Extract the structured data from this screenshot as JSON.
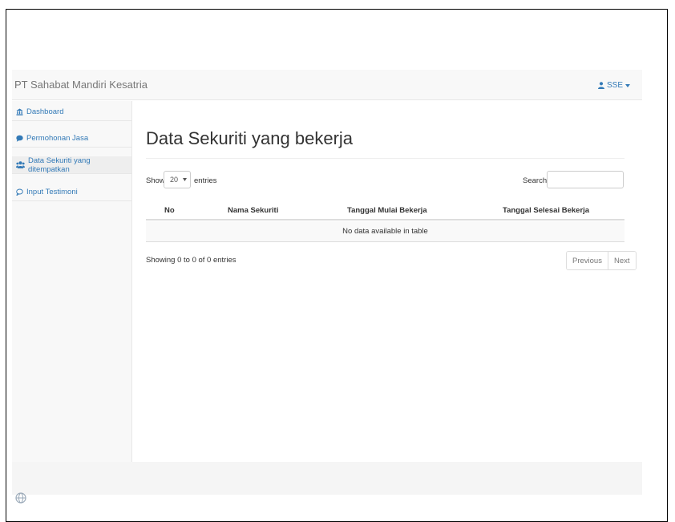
{
  "navbar": {
    "brand": "PT Sahabat Mandiri Kesatria",
    "user_label": "SSE"
  },
  "sidebar": {
    "items": [
      {
        "label": "Dashboard",
        "icon": "bank-icon",
        "active": false
      },
      {
        "label": "Permohonan Jasa",
        "icon": "comment-icon",
        "active": false
      },
      {
        "label": "Data Sekuriti yang ditempatkan",
        "icon": "users-icon",
        "active": true
      },
      {
        "label": "Input Testimoni",
        "icon": "comment-outline-icon",
        "active": false
      }
    ]
  },
  "main": {
    "title": "Data Sekuriti yang bekerja",
    "length": {
      "show_label": "Show",
      "selected": "20",
      "entries_label": "entries"
    },
    "search_label": "Search:",
    "columns": [
      "No",
      "Nama Sekuriti",
      "Tanggal Mulai Bekerja",
      "Tanggal Selesai Bekerja"
    ],
    "empty_message": "No data available in table",
    "info": "Showing 0 to 0 of 0 entries",
    "pagination": {
      "previous": "Previous",
      "next": "Next"
    }
  },
  "colors": {
    "link": "#337ab7",
    "navbar_bg": "#f8f8f8",
    "active_item_bg": "#eeeeee"
  }
}
